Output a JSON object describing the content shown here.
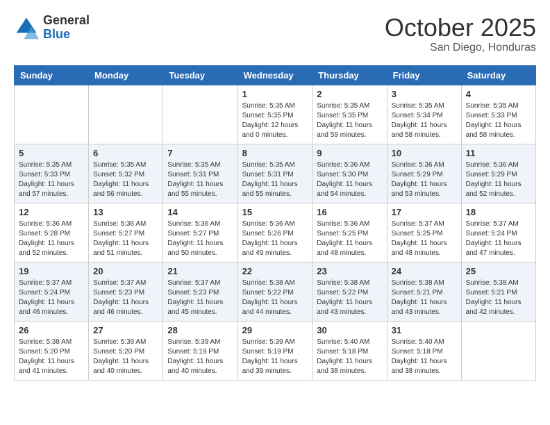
{
  "logo": {
    "general": "General",
    "blue": "Blue"
  },
  "header": {
    "month": "October 2025",
    "location": "San Diego, Honduras"
  },
  "days_of_week": [
    "Sunday",
    "Monday",
    "Tuesday",
    "Wednesday",
    "Thursday",
    "Friday",
    "Saturday"
  ],
  "weeks": [
    [
      {
        "day": "",
        "info": ""
      },
      {
        "day": "",
        "info": ""
      },
      {
        "day": "",
        "info": ""
      },
      {
        "day": "1",
        "info": "Sunrise: 5:35 AM\nSunset: 5:35 PM\nDaylight: 12 hours\nand 0 minutes."
      },
      {
        "day": "2",
        "info": "Sunrise: 5:35 AM\nSunset: 5:35 PM\nDaylight: 11 hours\nand 59 minutes."
      },
      {
        "day": "3",
        "info": "Sunrise: 5:35 AM\nSunset: 5:34 PM\nDaylight: 11 hours\nand 58 minutes."
      },
      {
        "day": "4",
        "info": "Sunrise: 5:35 AM\nSunset: 5:33 PM\nDaylight: 11 hours\nand 58 minutes."
      }
    ],
    [
      {
        "day": "5",
        "info": "Sunrise: 5:35 AM\nSunset: 5:33 PM\nDaylight: 11 hours\nand 57 minutes."
      },
      {
        "day": "6",
        "info": "Sunrise: 5:35 AM\nSunset: 5:32 PM\nDaylight: 11 hours\nand 56 minutes."
      },
      {
        "day": "7",
        "info": "Sunrise: 5:35 AM\nSunset: 5:31 PM\nDaylight: 11 hours\nand 55 minutes."
      },
      {
        "day": "8",
        "info": "Sunrise: 5:35 AM\nSunset: 5:31 PM\nDaylight: 11 hours\nand 55 minutes."
      },
      {
        "day": "9",
        "info": "Sunrise: 5:36 AM\nSunset: 5:30 PM\nDaylight: 11 hours\nand 54 minutes."
      },
      {
        "day": "10",
        "info": "Sunrise: 5:36 AM\nSunset: 5:29 PM\nDaylight: 11 hours\nand 53 minutes."
      },
      {
        "day": "11",
        "info": "Sunrise: 5:36 AM\nSunset: 5:29 PM\nDaylight: 11 hours\nand 52 minutes."
      }
    ],
    [
      {
        "day": "12",
        "info": "Sunrise: 5:36 AM\nSunset: 5:28 PM\nDaylight: 11 hours\nand 52 minutes."
      },
      {
        "day": "13",
        "info": "Sunrise: 5:36 AM\nSunset: 5:27 PM\nDaylight: 11 hours\nand 51 minutes."
      },
      {
        "day": "14",
        "info": "Sunrise: 5:36 AM\nSunset: 5:27 PM\nDaylight: 11 hours\nand 50 minutes."
      },
      {
        "day": "15",
        "info": "Sunrise: 5:36 AM\nSunset: 5:26 PM\nDaylight: 11 hours\nand 49 minutes."
      },
      {
        "day": "16",
        "info": "Sunrise: 5:36 AM\nSunset: 5:25 PM\nDaylight: 11 hours\nand 48 minutes."
      },
      {
        "day": "17",
        "info": "Sunrise: 5:37 AM\nSunset: 5:25 PM\nDaylight: 11 hours\nand 48 minutes."
      },
      {
        "day": "18",
        "info": "Sunrise: 5:37 AM\nSunset: 5:24 PM\nDaylight: 11 hours\nand 47 minutes."
      }
    ],
    [
      {
        "day": "19",
        "info": "Sunrise: 5:37 AM\nSunset: 5:24 PM\nDaylight: 11 hours\nand 46 minutes."
      },
      {
        "day": "20",
        "info": "Sunrise: 5:37 AM\nSunset: 5:23 PM\nDaylight: 11 hours\nand 46 minutes."
      },
      {
        "day": "21",
        "info": "Sunrise: 5:37 AM\nSunset: 5:23 PM\nDaylight: 11 hours\nand 45 minutes."
      },
      {
        "day": "22",
        "info": "Sunrise: 5:38 AM\nSunset: 5:22 PM\nDaylight: 11 hours\nand 44 minutes."
      },
      {
        "day": "23",
        "info": "Sunrise: 5:38 AM\nSunset: 5:22 PM\nDaylight: 11 hours\nand 43 minutes."
      },
      {
        "day": "24",
        "info": "Sunrise: 5:38 AM\nSunset: 5:21 PM\nDaylight: 11 hours\nand 43 minutes."
      },
      {
        "day": "25",
        "info": "Sunrise: 5:38 AM\nSunset: 5:21 PM\nDaylight: 11 hours\nand 42 minutes."
      }
    ],
    [
      {
        "day": "26",
        "info": "Sunrise: 5:38 AM\nSunset: 5:20 PM\nDaylight: 11 hours\nand 41 minutes."
      },
      {
        "day": "27",
        "info": "Sunrise: 5:39 AM\nSunset: 5:20 PM\nDaylight: 11 hours\nand 40 minutes."
      },
      {
        "day": "28",
        "info": "Sunrise: 5:39 AM\nSunset: 5:19 PM\nDaylight: 11 hours\nand 40 minutes."
      },
      {
        "day": "29",
        "info": "Sunrise: 5:39 AM\nSunset: 5:19 PM\nDaylight: 11 hours\nand 39 minutes."
      },
      {
        "day": "30",
        "info": "Sunrise: 5:40 AM\nSunset: 5:18 PM\nDaylight: 11 hours\nand 38 minutes."
      },
      {
        "day": "31",
        "info": "Sunrise: 5:40 AM\nSunset: 5:18 PM\nDaylight: 11 hours\nand 38 minutes."
      },
      {
        "day": "",
        "info": ""
      }
    ]
  ]
}
